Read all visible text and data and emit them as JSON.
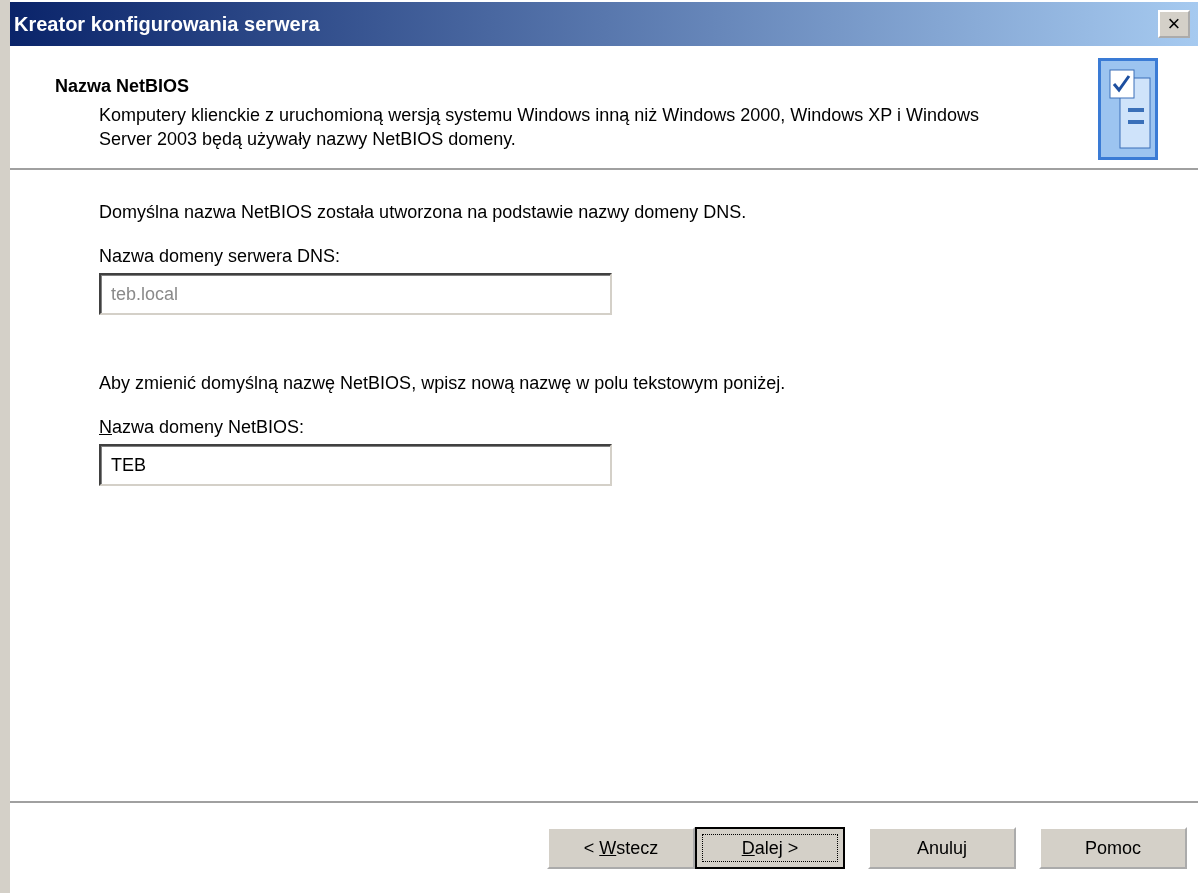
{
  "window": {
    "title": "Kreator konfigurowania serwera",
    "close_label": "×"
  },
  "header": {
    "title": "Nazwa NetBIOS",
    "description": "Komputery klienckie z uruchomioną wersją systemu Windows inną niż Windows 2000, Windows XP i Windows Server 2003 będą używały nazwy NetBIOS domeny."
  },
  "content": [
    {
      "kind": "text",
      "text": "Domyślna nazwa NetBIOS została utworzona na podstawie nazwy domeny DNS."
    },
    {
      "kind": "label",
      "parts": {
        "after": "Nazwa domeny serwera DNS:"
      }
    },
    {
      "kind": "field",
      "value": "teb.local",
      "disabled": true
    },
    {
      "kind": "text",
      "text": "Aby zmienić domyślną nazwę NetBIOS, wpisz nową nazwę w polu tekstowym poniżej."
    },
    {
      "kind": "label",
      "parts": {
        "key": "N",
        "after": "azwa domeny NetBIOS:"
      }
    },
    {
      "kind": "field",
      "value": "TEB",
      "disabled": false
    }
  ],
  "buttons": [
    {
      "parts": {
        "before": "< ",
        "key": "W",
        "after": "stecz"
      },
      "default": false
    },
    {
      "parts": {
        "key": "D",
        "after": "alej >"
      },
      "default": true
    },
    {
      "parts": {
        "after": "Anuluj"
      },
      "default": false
    },
    {
      "parts": {
        "after": "Pomoc"
      },
      "default": false
    }
  ]
}
